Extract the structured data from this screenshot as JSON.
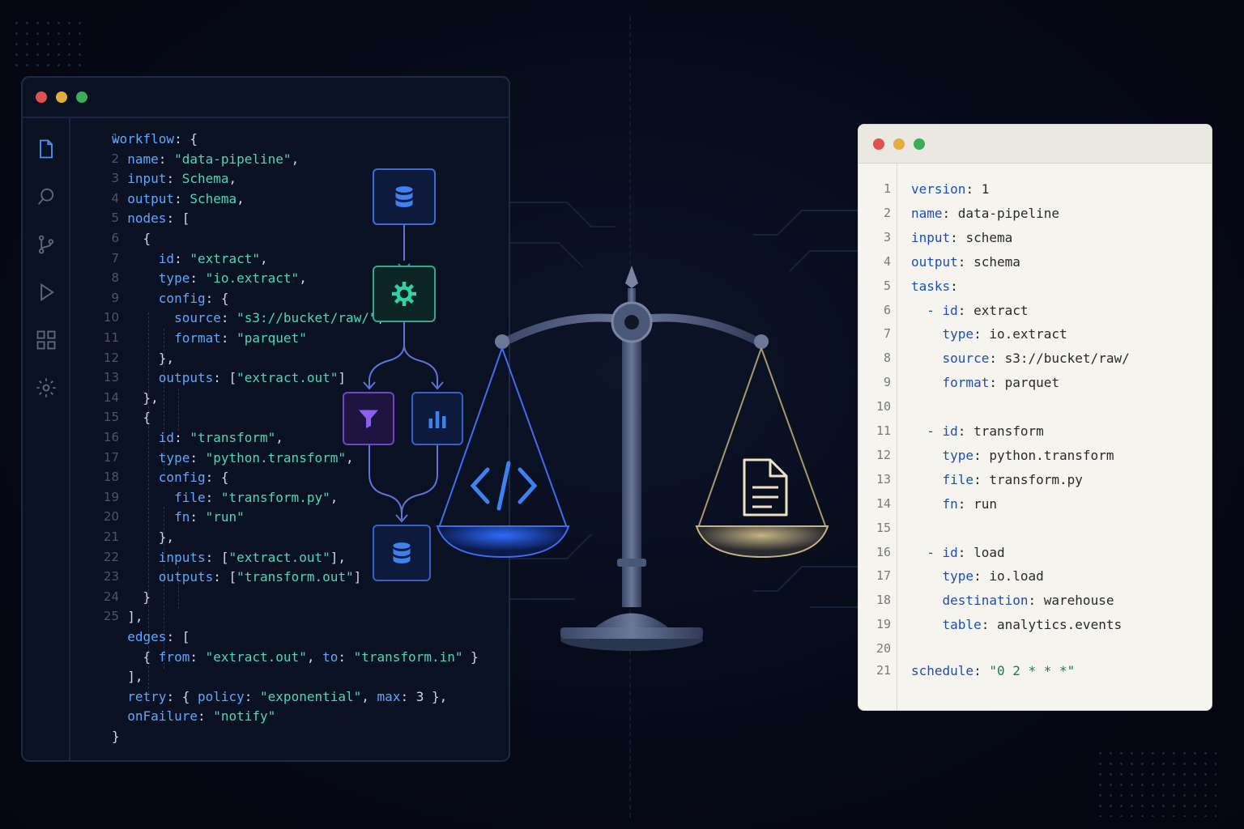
{
  "left_editor": {
    "line_numbers": [
      "1",
      "2",
      "3",
      "4",
      "5",
      "6",
      "7",
      "8",
      "9",
      "10",
      "11",
      "12",
      "13",
      "14",
      "15",
      "16",
      "17",
      "18",
      "19",
      "20",
      "21",
      "22",
      "23",
      "24",
      "25"
    ],
    "lines": [
      [
        {
          "t": "workflow",
          "c": "k"
        },
        {
          "t": ": {",
          "c": "p"
        }
      ],
      [
        {
          "t": "  name",
          "c": "k"
        },
        {
          "t": ": ",
          "c": "p"
        },
        {
          "t": "\"data-pipeline\"",
          "c": "s"
        },
        {
          "t": ",",
          "c": "p"
        }
      ],
      [
        {
          "t": "  input",
          "c": "k"
        },
        {
          "t": ": ",
          "c": "p"
        },
        {
          "t": "Schema",
          "c": "s"
        },
        {
          "t": ",",
          "c": "p"
        }
      ],
      [
        {
          "t": "  output",
          "c": "k"
        },
        {
          "t": ": ",
          "c": "p"
        },
        {
          "t": "Schema",
          "c": "s"
        },
        {
          "t": ",",
          "c": "p"
        }
      ],
      [
        {
          "t": "  nodes",
          "c": "k"
        },
        {
          "t": ": [",
          "c": "p"
        }
      ],
      [
        {
          "t": "    {",
          "c": "p"
        }
      ],
      [
        {
          "t": "      id",
          "c": "k"
        },
        {
          "t": ": ",
          "c": "p"
        },
        {
          "t": "\"extract\"",
          "c": "s"
        },
        {
          "t": ",",
          "c": "p"
        }
      ],
      [
        {
          "t": "      type",
          "c": "k"
        },
        {
          "t": ": ",
          "c": "p"
        },
        {
          "t": "\"io.extract\"",
          "c": "s"
        },
        {
          "t": ",",
          "c": "p"
        }
      ],
      [
        {
          "t": "      config",
          "c": "k"
        },
        {
          "t": ": {",
          "c": "p"
        }
      ],
      [
        {
          "t": "        source",
          "c": "k"
        },
        {
          "t": ": ",
          "c": "p"
        },
        {
          "t": "\"s3://bucket/raw/\"",
          "c": "s"
        },
        {
          "t": ",",
          "c": "p"
        }
      ],
      [
        {
          "t": "        format",
          "c": "k"
        },
        {
          "t": ": ",
          "c": "p"
        },
        {
          "t": "\"parquet\"",
          "c": "s"
        }
      ],
      [
        {
          "t": "      },",
          "c": "p"
        }
      ],
      [
        {
          "t": "      outputs",
          "c": "k"
        },
        {
          "t": ": [",
          "c": "p"
        },
        {
          "t": "\"extract.out\"",
          "c": "s"
        },
        {
          "t": "]",
          "c": "p"
        }
      ],
      [
        {
          "t": "    },",
          "c": "p"
        }
      ],
      [
        {
          "t": "    {",
          "c": "p"
        }
      ],
      [
        {
          "t": "      id",
          "c": "k"
        },
        {
          "t": ": ",
          "c": "p"
        },
        {
          "t": "\"transform\"",
          "c": "s"
        },
        {
          "t": ",",
          "c": "p"
        }
      ],
      [
        {
          "t": "      type",
          "c": "k"
        },
        {
          "t": ": ",
          "c": "p"
        },
        {
          "t": "\"python.transform\"",
          "c": "s"
        },
        {
          "t": ",",
          "c": "p"
        }
      ],
      [
        {
          "t": "      config",
          "c": "k"
        },
        {
          "t": ": {",
          "c": "p"
        }
      ],
      [
        {
          "t": "        file",
          "c": "k"
        },
        {
          "t": ": ",
          "c": "p"
        },
        {
          "t": "\"transform.py\"",
          "c": "s"
        },
        {
          "t": ",",
          "c": "p"
        }
      ],
      [
        {
          "t": "        fn",
          "c": "k"
        },
        {
          "t": ": ",
          "c": "p"
        },
        {
          "t": "\"run\"",
          "c": "s"
        }
      ],
      [
        {
          "t": "      },",
          "c": "p"
        }
      ],
      [
        {
          "t": "      inputs",
          "c": "k"
        },
        {
          "t": ": [",
          "c": "p"
        },
        {
          "t": "\"extract.out\"",
          "c": "s"
        },
        {
          "t": "],",
          "c": "p"
        }
      ],
      [
        {
          "t": "      outputs",
          "c": "k"
        },
        {
          "t": ": [",
          "c": "p"
        },
        {
          "t": "\"transform.out\"",
          "c": "s"
        },
        {
          "t": "]",
          "c": "p"
        }
      ],
      [
        {
          "t": "    }",
          "c": "p"
        }
      ],
      [
        {
          "t": "  ],",
          "c": "p"
        }
      ],
      [
        {
          "t": "  edges",
          "c": "k"
        },
        {
          "t": ": [",
          "c": "p"
        }
      ],
      [
        {
          "t": "    { ",
          "c": "p"
        },
        {
          "t": "from",
          "c": "k"
        },
        {
          "t": ": ",
          "c": "p"
        },
        {
          "t": "\"extract.out\"",
          "c": "s"
        },
        {
          "t": ", ",
          "c": "p"
        },
        {
          "t": "to",
          "c": "k"
        },
        {
          "t": ": ",
          "c": "p"
        },
        {
          "t": "\"transform.in\"",
          "c": "s"
        },
        {
          "t": " }",
          "c": "p"
        }
      ],
      [
        {
          "t": "  ],",
          "c": "p"
        }
      ],
      [
        {
          "t": "  retry",
          "c": "k"
        },
        {
          "t": ": { ",
          "c": "p"
        },
        {
          "t": "policy",
          "c": "k"
        },
        {
          "t": ": ",
          "c": "p"
        },
        {
          "t": "\"exponential\"",
          "c": "s"
        },
        {
          "t": ", ",
          "c": "p"
        },
        {
          "t": "max",
          "c": "k"
        },
        {
          "t": ": 3 },",
          "c": "p"
        }
      ],
      [
        {
          "t": "  onFailure",
          "c": "k"
        },
        {
          "t": ": ",
          "c": "p"
        },
        {
          "t": "\"notify\"",
          "c": "s"
        }
      ],
      [
        {
          "t": "}",
          "c": "p"
        }
      ]
    ],
    "activity_icons": [
      "file-icon",
      "search-icon",
      "source-control-icon",
      "run-icon",
      "extensions-icon",
      "settings-gear-icon"
    ]
  },
  "flow_diagram": {
    "nodes": [
      "database-icon",
      "gear-icon",
      "filter-icon",
      "bar-chart-icon",
      "database-icon"
    ]
  },
  "balance": {
    "left_pan_icon": "code-brackets-icon",
    "right_pan_icon": "document-icon"
  },
  "yaml_editor": {
    "lines": [
      {
        "n": "1",
        "parts": [
          {
            "t": "version",
            "c": "yk"
          },
          {
            "t": ": 1",
            "c": "yv"
          }
        ]
      },
      {
        "n": "2",
        "parts": [
          {
            "t": "name",
            "c": "yk"
          },
          {
            "t": ": data-pipeline",
            "c": "yv"
          }
        ]
      },
      {
        "n": "3",
        "parts": [
          {
            "t": "input",
            "c": "yk"
          },
          {
            "t": ": schema",
            "c": "yv"
          }
        ]
      },
      {
        "n": "4",
        "parts": [
          {
            "t": "output",
            "c": "yk"
          },
          {
            "t": ": schema",
            "c": "yv"
          }
        ]
      },
      {
        "n": "5",
        "parts": [
          {
            "t": "tasks",
            "c": "yk"
          },
          {
            "t": ":",
            "c": "yv"
          }
        ]
      },
      {
        "n": "6",
        "parts": [
          {
            "t": "  - ",
            "c": "yk"
          },
          {
            "t": "id",
            "c": "yk"
          },
          {
            "t": ": extract",
            "c": "yv"
          }
        ]
      },
      {
        "n": "7",
        "parts": [
          {
            "t": "    type",
            "c": "yk"
          },
          {
            "t": ": io.extract",
            "c": "yv"
          }
        ]
      },
      {
        "n": "8",
        "parts": [
          {
            "t": "    source",
            "c": "yk"
          },
          {
            "t": ": s3://bucket/raw/",
            "c": "yv"
          }
        ]
      },
      {
        "n": "9",
        "parts": [
          {
            "t": "    format",
            "c": "yk"
          },
          {
            "t": ": parquet",
            "c": "yv"
          }
        ]
      },
      {
        "n": "10",
        "parts": []
      },
      {
        "n": "11",
        "parts": [
          {
            "t": "  - ",
            "c": "yk"
          },
          {
            "t": "id",
            "c": "yk"
          },
          {
            "t": ": transform",
            "c": "yv"
          }
        ]
      },
      {
        "n": "12",
        "parts": [
          {
            "t": "    type",
            "c": "yk"
          },
          {
            "t": ": python.transform",
            "c": "yv"
          }
        ]
      },
      {
        "n": "13",
        "parts": [
          {
            "t": "    file",
            "c": "yk"
          },
          {
            "t": ": transform.py",
            "c": "yv"
          }
        ]
      },
      {
        "n": "14",
        "parts": [
          {
            "t": "    fn",
            "c": "yk"
          },
          {
            "t": ": run",
            "c": "yv"
          }
        ]
      },
      {
        "n": "15",
        "parts": []
      },
      {
        "n": "16",
        "parts": [
          {
            "t": "  - ",
            "c": "yk"
          },
          {
            "t": "id",
            "c": "yk"
          },
          {
            "t": ": load",
            "c": "yv"
          }
        ]
      },
      {
        "n": "17",
        "parts": [
          {
            "t": "    type",
            "c": "yk"
          },
          {
            "t": ": io.load",
            "c": "yv"
          }
        ]
      },
      {
        "n": "18",
        "parts": [
          {
            "t": "    destination",
            "c": "yk"
          },
          {
            "t": ": warehouse",
            "c": "yv"
          }
        ]
      },
      {
        "n": "19",
        "parts": [
          {
            "t": "    table",
            "c": "yk"
          },
          {
            "t": ": analytics.events",
            "c": "yv"
          }
        ]
      },
      {
        "n": "20",
        "parts": []
      },
      {
        "n": "21",
        "parts": [
          {
            "t": "schedule",
            "c": "yk"
          },
          {
            "t": ": ",
            "c": "yv"
          },
          {
            "t": "\"0 2 * * *\"",
            "c": "ys"
          }
        ]
      }
    ]
  },
  "colors": {
    "accent_blue": "#5aa9ff",
    "accent_teal": "#4ad9b6",
    "yaml_key": "#1d4fb3"
  }
}
